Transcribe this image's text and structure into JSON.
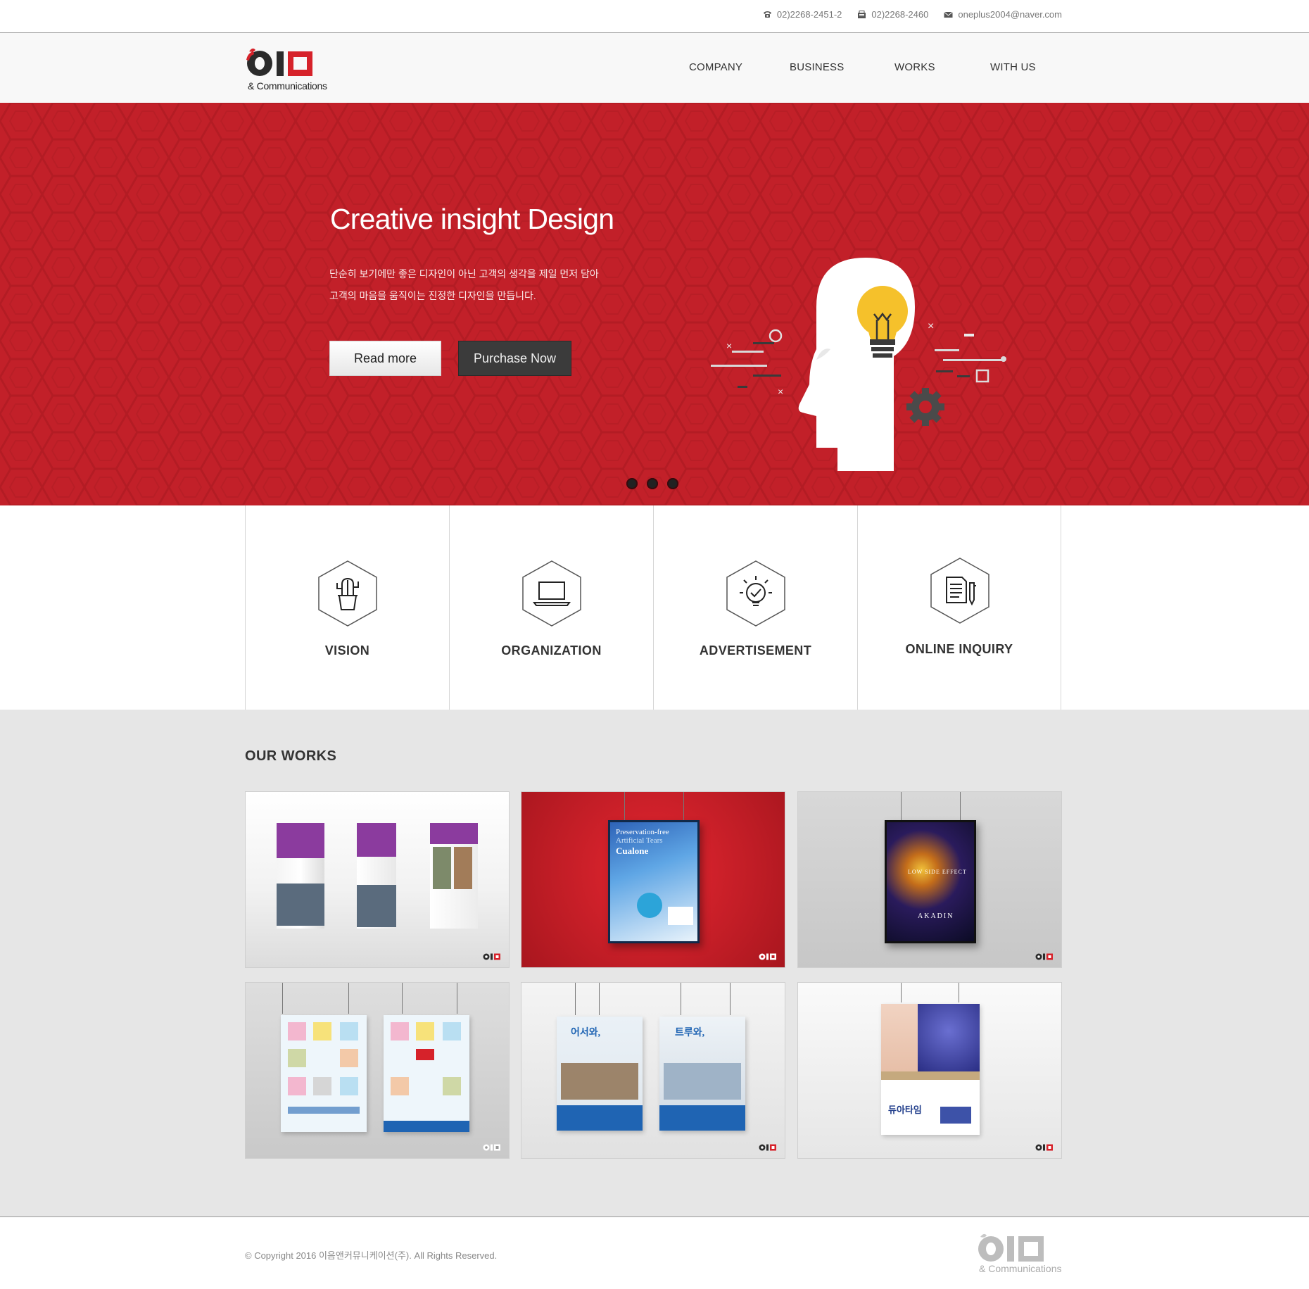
{
  "topbar": {
    "phone": {
      "icon": "phone-icon",
      "text": "02)2268-2451-2"
    },
    "fax": {
      "icon": "fax-icon",
      "text": "02)2268-2460"
    },
    "email": {
      "icon": "mail-icon",
      "text": "oneplus2004@naver.com"
    }
  },
  "header": {
    "logo_sub": "& Communications",
    "nav": [
      "COMPANY",
      "BUSINESS",
      "WORKS",
      "WITH US"
    ]
  },
  "hero": {
    "title": "Creative insight Design",
    "desc_line1": "단순히 보기에만 좋은 디자인이 아닌 고객의 생각을 제일 먼저 담아",
    "desc_line2": "고객의 마음을 움직이는 진정한 디자인을 만듭니다.",
    "read_more": "Read more",
    "purchase": "Purchase Now",
    "slides": 3,
    "accent": "#c22029",
    "illustration": "head-lightbulb-illustration"
  },
  "features": [
    {
      "label": "VISION",
      "icon": "cactus-icon"
    },
    {
      "label": "ORGANIZATION",
      "icon": "laptop-icon"
    },
    {
      "label": "ADVERTISEMENT",
      "icon": "lightbulb-check-icon"
    },
    {
      "label": "ONLINE INQUIRY",
      "icon": "document-pen-icon"
    }
  ],
  "works": {
    "title": "OUR WORKS",
    "items": [
      {
        "name": "work-boxes"
      },
      {
        "name": "work-cualone-poster",
        "poster_title": "Preservation-free",
        "poster_sub": "Artificial Tears",
        "poster_brand": "Cualone"
      },
      {
        "name": "work-akadin-poster",
        "poster_title": "LOW SIDE EFFECT",
        "poster_sub": "AKADIN"
      },
      {
        "name": "work-people-posters"
      },
      {
        "name": "work-box-character-posters",
        "poster_title_a": "어서와,",
        "poster_title_b": "트루와,"
      },
      {
        "name": "work-beauty-poster",
        "poster_title": "듀아타임"
      }
    ]
  },
  "footer": {
    "copyright": "© Copyright 2016 이음앤커뮤니케이션(주). All Rights Reserved.",
    "logo_sub": "& Communications"
  }
}
